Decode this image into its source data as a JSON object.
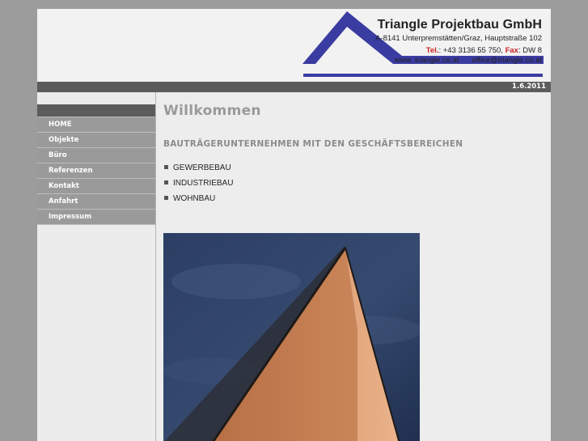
{
  "header": {
    "company": "Triangle Projektbau GmbH",
    "address": "A-8141 Unterpremstätten/Graz, Hauptstraße 102",
    "tel_label": "Tel.",
    "tel_value": ": +43 3136 55 750,",
    "fax_label": "Fax",
    "fax_value": ": DW 8",
    "web": "www. triangle.co.at",
    "email": "office@triangle.co.at",
    "brand_color": "#3b3ca1"
  },
  "datebar": {
    "date": "1.6.2011"
  },
  "nav": {
    "items": [
      {
        "label": "HOME"
      },
      {
        "label": "Objekte"
      },
      {
        "label": "Büro"
      },
      {
        "label": "Referenzen"
      },
      {
        "label": "Kontakt"
      },
      {
        "label": "Anfahrt"
      },
      {
        "label": "Impressum"
      }
    ]
  },
  "main": {
    "title": "Willkommen",
    "subheading": "BAUTRÄGERUNTERNEHMEN MIT DEN GESCHÄFTSBEREICHEN",
    "areas": [
      {
        "label": "GEWERBEBAU"
      },
      {
        "label": "INDUSTRIEBAU"
      },
      {
        "label": "WOHNBAU"
      }
    ]
  }
}
